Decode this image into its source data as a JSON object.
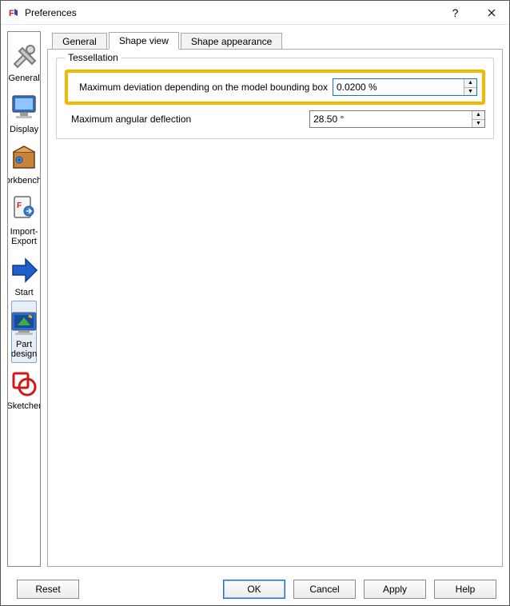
{
  "window": {
    "title": "Preferences"
  },
  "sidebar": {
    "items": [
      {
        "key": "general",
        "label": "General"
      },
      {
        "key": "display",
        "label": "Display"
      },
      {
        "key": "workbenches",
        "label": "Workbenches"
      },
      {
        "key": "import-export",
        "label": "Import-Export"
      },
      {
        "key": "start",
        "label": "Start"
      },
      {
        "key": "part-design",
        "label": "Part design",
        "selected": true
      },
      {
        "key": "sketcher",
        "label": "Sketcher"
      }
    ]
  },
  "tabs": {
    "items": [
      {
        "key": "general",
        "label": "General"
      },
      {
        "key": "shape-view",
        "label": "Shape view",
        "active": true
      },
      {
        "key": "shape-appearance",
        "label": "Shape appearance"
      }
    ]
  },
  "tessellation": {
    "legend": "Tessellation",
    "fields": {
      "max_deviation": {
        "label": "Maximum deviation depending on the model bounding box",
        "value": "0.0200 %",
        "highlighted": true
      },
      "max_angular": {
        "label": "Maximum angular deflection",
        "value": "28.50 °"
      }
    }
  },
  "buttons": {
    "reset": "Reset",
    "ok": "OK",
    "cancel": "Cancel",
    "apply": "Apply",
    "help": "Help"
  }
}
